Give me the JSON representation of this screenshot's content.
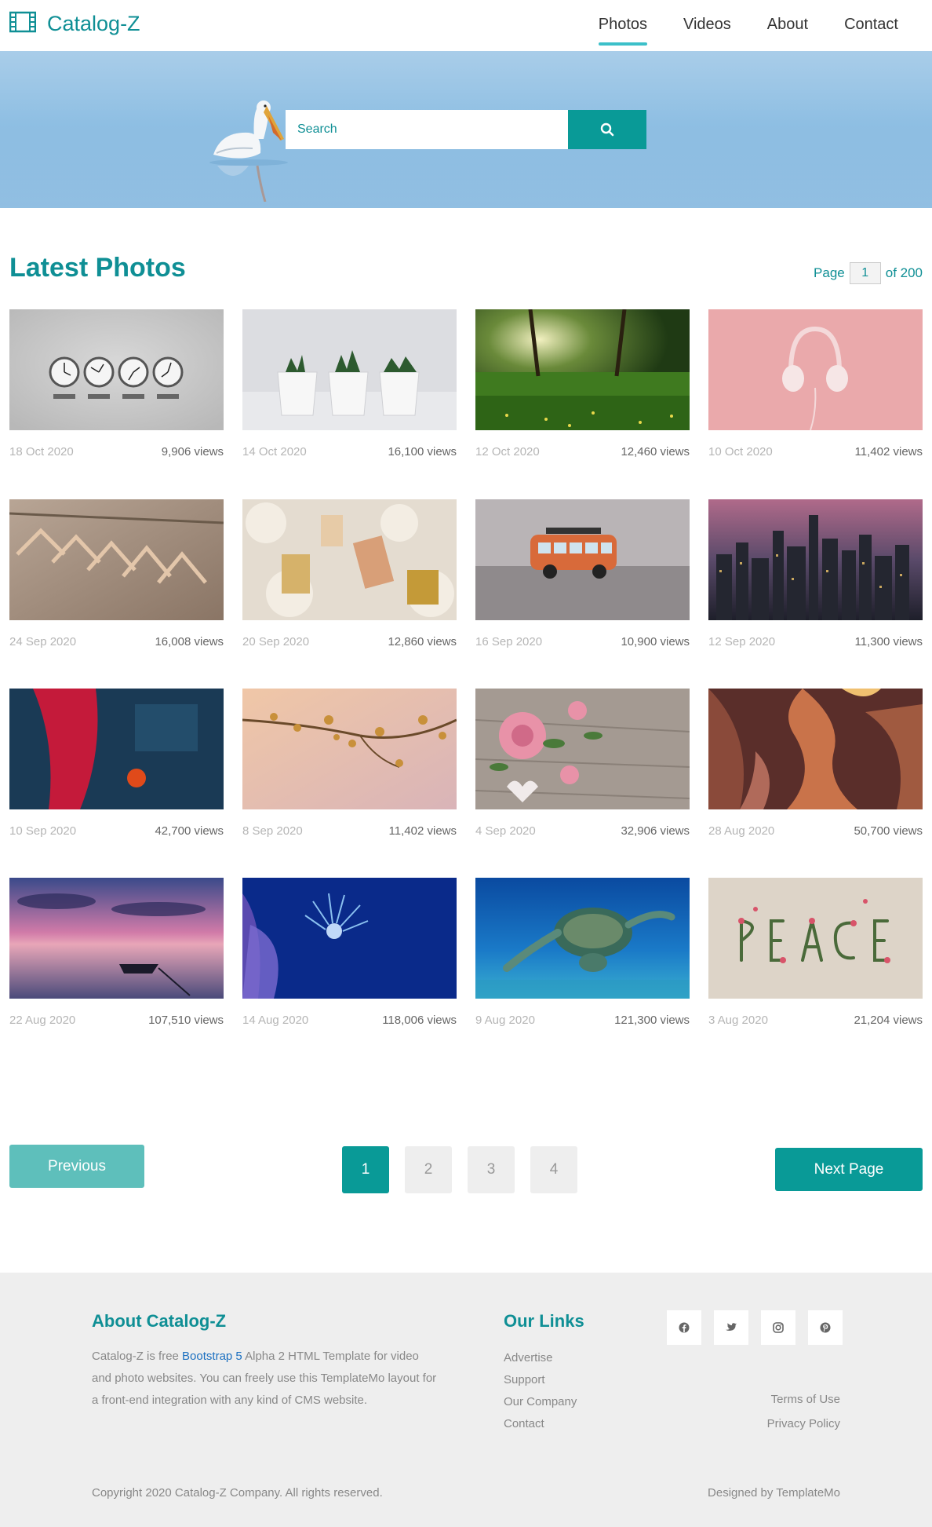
{
  "brand": {
    "name": "Catalog-Z",
    "icon": "film-icon",
    "color": "#0f8f95"
  },
  "nav": {
    "items": [
      {
        "label": "Photos",
        "active": true
      },
      {
        "label": "Videos",
        "active": false
      },
      {
        "label": "About",
        "active": false
      },
      {
        "label": "Contact",
        "active": false
      }
    ]
  },
  "hero": {
    "search_placeholder": "Search",
    "search_icon": "search-icon"
  },
  "section": {
    "title": "Latest Photos",
    "page_prefix": "Page",
    "page_current": "1",
    "page_suffix": "of 200"
  },
  "photos": [
    {
      "date": "18 Oct 2020",
      "views": "9,906 views",
      "subject": "clocks"
    },
    {
      "date": "14 Oct 2020",
      "views": "16,100 views",
      "subject": "plants"
    },
    {
      "date": "12 Oct 2020",
      "views": "12,460 views",
      "subject": "forest"
    },
    {
      "date": "10 Oct 2020",
      "views": "11,402 views",
      "subject": "headphones"
    },
    {
      "date": "24 Sep 2020",
      "views": "16,008 views",
      "subject": "hangers"
    },
    {
      "date": "20 Sep 2020",
      "views": "12,860 views",
      "subject": "perfume"
    },
    {
      "date": "16 Sep 2020",
      "views": "10,900 views",
      "subject": "toy-bus"
    },
    {
      "date": "12 Sep 2020",
      "views": "11,300 views",
      "subject": "city"
    },
    {
      "date": "10 Sep 2020",
      "views": "42,700 views",
      "subject": "abstract"
    },
    {
      "date": "8 Sep 2020",
      "views": "11,402 views",
      "subject": "blossom"
    },
    {
      "date": "4 Sep 2020",
      "views": "32,906 views",
      "subject": "roses"
    },
    {
      "date": "28 Aug 2020",
      "views": "50,700 views",
      "subject": "canyon"
    },
    {
      "date": "22 Aug 2020",
      "views": "107,510 views",
      "subject": "sunset-boat"
    },
    {
      "date": "14 Aug 2020",
      "views": "118,006 views",
      "subject": "sea-anemone"
    },
    {
      "date": "9 Aug 2020",
      "views": "121,300 views",
      "subject": "turtle"
    },
    {
      "date": "3 Aug 2020",
      "views": "21,204 views",
      "subject": "peace"
    }
  ],
  "pagination": {
    "previous": "Previous",
    "pages": [
      "1",
      "2",
      "3",
      "4"
    ],
    "active": "1",
    "next": "Next Page"
  },
  "footer": {
    "about_title": "About Catalog-Z",
    "about_text_1": "Catalog-Z is free ",
    "about_link": "Bootstrap 5",
    "about_text_2": " Alpha 2 HTML Template for video and photo websites. You can freely use this TemplateMo layout for a front-end integration with any kind of CMS website.",
    "links_title": "Our Links",
    "links": [
      "Advertise",
      "Support",
      "Our Company",
      "Contact"
    ],
    "socials": [
      "facebook-icon",
      "twitter-icon",
      "instagram-icon",
      "pinterest-icon"
    ],
    "terms": "Terms of Use",
    "privacy": "Privacy Policy",
    "copyright": "Copyright 2020 Catalog-Z Company. All rights reserved.",
    "designed_by": "Designed by TemplateMo"
  },
  "colors": {
    "accent": "#099a97",
    "accent_light": "#5ebfbb",
    "nav_underline": "#3cc0c9",
    "footer_bg": "#eeeeee"
  }
}
